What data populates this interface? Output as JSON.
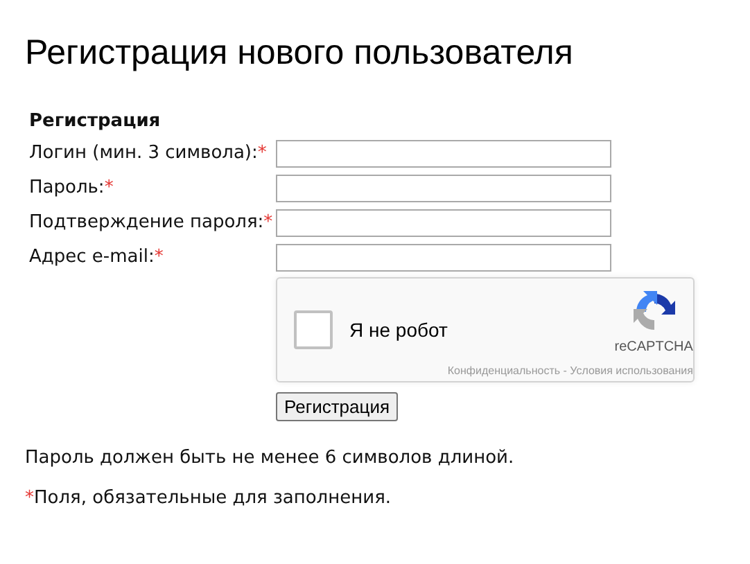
{
  "title": "Регистрация нового пользователя",
  "form": {
    "heading": "Регистрация",
    "required_mark": "*",
    "fields": [
      {
        "label": "Логин (мин. 3 символа):",
        "required": true
      },
      {
        "label": "Пароль:",
        "required": true
      },
      {
        "label": "Подтверждение пароля:",
        "required": true
      },
      {
        "label": "Адрес e-mail:",
        "required": true
      }
    ],
    "captcha": {
      "label": "Я не робот",
      "checked": false,
      "brand": "reCAPTCHA",
      "privacy": "Конфиденциальность",
      "separator": " - ",
      "terms": "Условия использования"
    },
    "submit": "Регистрация"
  },
  "notes": [
    {
      "text": "Пароль должен быть не менее 6 символов длиной.",
      "marked": false
    },
    {
      "text": "Поля, обязательные для заполнения.",
      "marked": true
    }
  ]
}
